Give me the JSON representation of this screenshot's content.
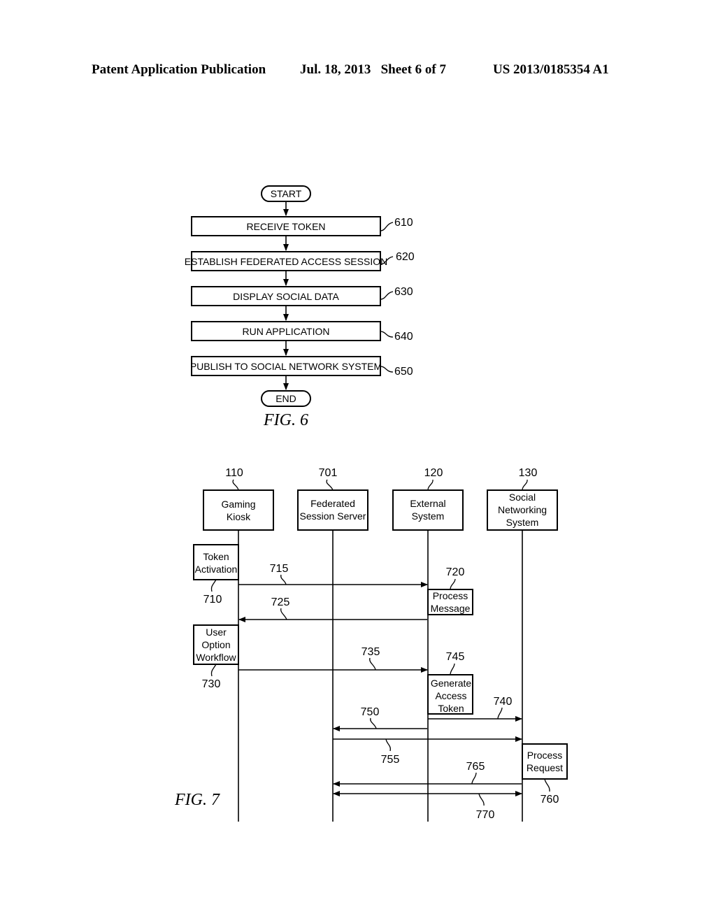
{
  "header": {
    "publication": "Patent Application Publication",
    "date_sheet": "Jul. 18, 2013   Sheet 6 of 7",
    "number": "US 2013/0185354 A1"
  },
  "fig6": {
    "caption": "FIG. 6",
    "start": "START",
    "end": "END",
    "steps": [
      {
        "ref": "610",
        "label": "RECEIVE TOKEN"
      },
      {
        "ref": "620",
        "label": "ESTABLISH FEDERATED ACCESS SESSION"
      },
      {
        "ref": "630",
        "label": "DISPLAY SOCIAL DATA"
      },
      {
        "ref": "640",
        "label": "RUN APPLICATION"
      },
      {
        "ref": "650",
        "label": "PUBLISH TO SOCIAL NETWORK SYSTEM"
      }
    ]
  },
  "fig7": {
    "caption": "FIG. 7",
    "actors": [
      {
        "ref": "110",
        "lines": [
          "Gaming",
          "Kiosk"
        ]
      },
      {
        "ref": "701",
        "lines": [
          "Federated",
          "Session Server"
        ]
      },
      {
        "ref": "120",
        "lines": [
          "External",
          "System"
        ]
      },
      {
        "ref": "130",
        "lines": [
          "Social",
          "Networking",
          "System"
        ]
      }
    ],
    "activities": [
      {
        "ref": "710",
        "lines": [
          "Token",
          "Activation"
        ]
      },
      {
        "ref": "720",
        "lines": [
          "Process",
          "Message"
        ]
      },
      {
        "ref": "730",
        "lines": [
          "User",
          "Option",
          "Workflow"
        ]
      },
      {
        "ref": "745",
        "lines": [
          "Generate",
          "Access",
          "Token"
        ]
      },
      {
        "ref": "760",
        "lines": [
          "Process",
          "Request"
        ]
      }
    ],
    "messages": [
      {
        "ref": "715",
        "from": "Gaming Kiosk",
        "to": "External System"
      },
      {
        "ref": "725",
        "from": "External System",
        "to": "Gaming Kiosk"
      },
      {
        "ref": "735",
        "from": "Gaming Kiosk",
        "to": "External System"
      },
      {
        "ref": "740",
        "from": "External System",
        "to": "Social Networking System"
      },
      {
        "ref": "750",
        "from": "External System",
        "to": "Federated Session Server"
      },
      {
        "ref": "755",
        "from": "Federated Session Server",
        "to": "Social Networking System"
      },
      {
        "ref": "765",
        "from": "Social Networking System",
        "to": "Federated Session Server"
      },
      {
        "ref": "770",
        "from": "Federated Session Server",
        "to": "Social Networking System",
        "bidirectional": true
      }
    ]
  }
}
